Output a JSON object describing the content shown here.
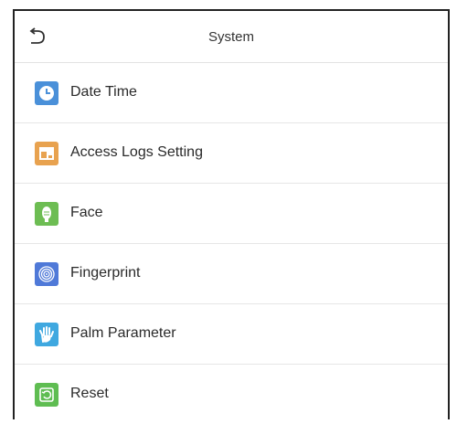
{
  "header": {
    "title": "System",
    "back_icon": "back-arrow-icon"
  },
  "menu": {
    "items": [
      {
        "label": "Date Time",
        "icon": "clock-icon",
        "color": "#4a90d9"
      },
      {
        "label": "Access Logs Setting",
        "icon": "access-logs-icon",
        "color": "#e8a24f"
      },
      {
        "label": "Face",
        "icon": "face-icon",
        "color": "#6dbd53"
      },
      {
        "label": "Fingerprint",
        "icon": "fingerprint-icon",
        "color": "#4f79d8"
      },
      {
        "label": "Palm Parameter",
        "icon": "palm-icon",
        "color": "#3fa8e0"
      },
      {
        "label": "Reset",
        "icon": "reset-icon",
        "color": "#5fbd52"
      }
    ]
  }
}
